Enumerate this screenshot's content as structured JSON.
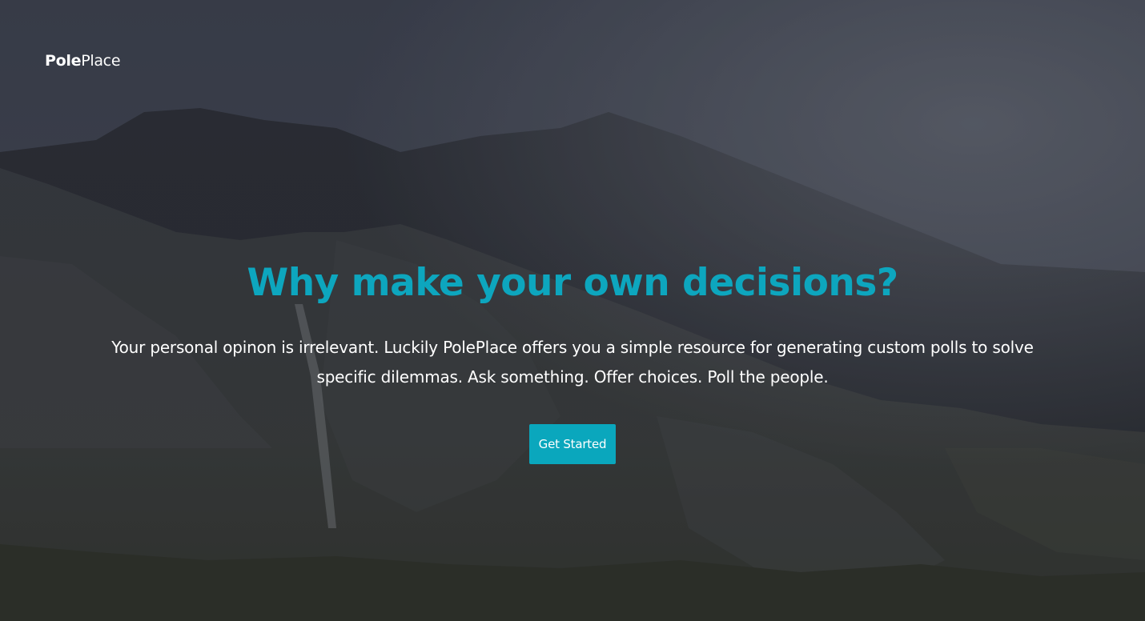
{
  "brand": {
    "name_bold": "Pole",
    "name_regular": "Place"
  },
  "hero": {
    "headline": "Why make your own decisions?",
    "lead": "Your personal opinon is irrelevant. Luckily PolePlace offers you a simple resource for generating custom polls to solve specific dilemmas. Ask something. Offer choices. Poll the people.",
    "cta_label": "Get Started"
  },
  "colors": {
    "accent": "#0aa7bd",
    "headline": "#0da6be",
    "text": "#ffffff"
  }
}
